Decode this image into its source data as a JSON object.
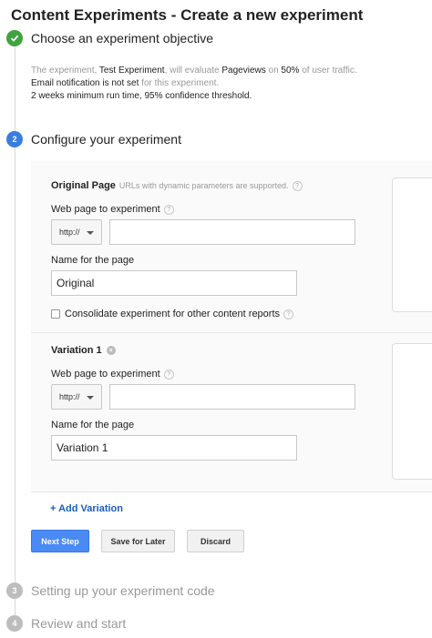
{
  "page_title": "Content Experiments - Create a new experiment",
  "steps": [
    {
      "number": "✓",
      "label": "Choose an experiment objective"
    },
    {
      "number": "2",
      "label": "Configure your experiment"
    },
    {
      "number": "3",
      "label": "Setting up your experiment code"
    },
    {
      "number": "4",
      "label": "Review and start"
    }
  ],
  "summary": {
    "t1": "The experiment, ",
    "experiment_name": "Test Experiment",
    "t2": ", will evaluate ",
    "metric": "Pageviews",
    "t3": " on ",
    "traffic": "50%",
    "t4": " of user traffic.",
    "email_status": "Email notification is not set",
    "t5": " for this experiment.",
    "threshold": "2 weeks minimum run time, 95% confidence threshold."
  },
  "original": {
    "title": "Original Page",
    "hint": "URLs with dynamic parameters are supported.",
    "url_label": "Web page to experiment",
    "protocol": "http://",
    "url_value": "",
    "name_label": "Name for the page",
    "name_value": "Original",
    "consolidate_label": "Consolidate experiment for other content reports"
  },
  "variation": {
    "title": "Variation 1",
    "url_label": "Web page to experiment",
    "protocol": "http://",
    "url_value": "",
    "name_label": "Name for the page",
    "name_value": "Variation 1"
  },
  "add_variation": "+ Add Variation",
  "buttons": {
    "next": "Next Step",
    "save": "Save for Later",
    "discard": "Discard"
  },
  "icons": {
    "help": "?",
    "remove": "×"
  }
}
